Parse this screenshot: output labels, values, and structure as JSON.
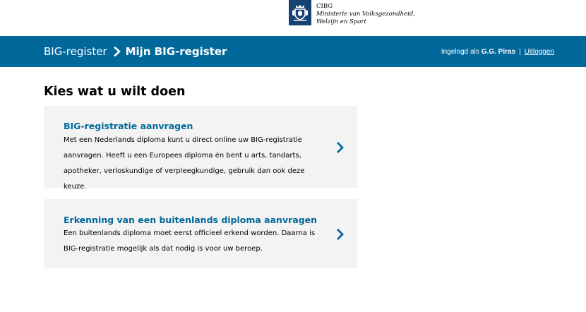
{
  "logo": {
    "org": "CIBG",
    "ministry_line1": "Ministerie van Volksgezondheid,",
    "ministry_line2": "Welzijn en Sport"
  },
  "header": {
    "breadcrumb_home": "BIG-register",
    "breadcrumb_current": "Mijn BIG-register",
    "logged_in_label": "Ingelogd als",
    "user_name": "G.G. Piras",
    "separator": "|",
    "logout_label": "Uitloggen"
  },
  "main": {
    "title": "Kies wat u wilt doen",
    "options": [
      {
        "title": "BIG-registratie aanvragen",
        "description": "Met een Nederlands diploma kunt u direct online uw BIG-registratie aanvragen. Heeft u een Europees diploma én bent u arts, tandarts, apotheker, verloskundige of verpleegkundige, gebruik dan ook deze keuze."
      },
      {
        "title": "Erkenning van een buitenlands diploma aanvragen",
        "description": "Een buitenlands diploma moet eerst officieel erkend worden. Daarna is BIG-registratie mogelijk als dat nodig is voor uw beroep."
      }
    ]
  },
  "colors": {
    "header_blue": "#01689b",
    "card_bg": "#f3f3f3",
    "logo_blue": "#154273"
  }
}
